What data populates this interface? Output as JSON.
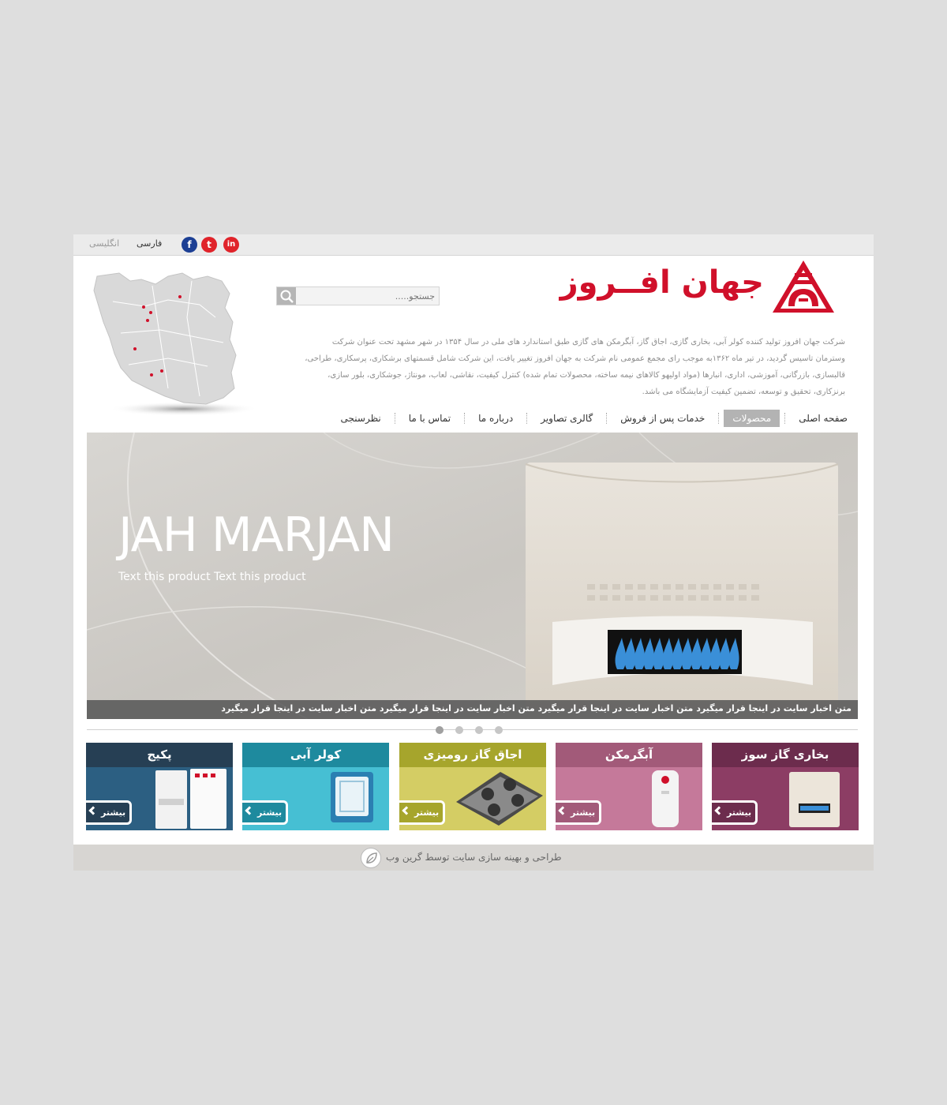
{
  "topbar": {
    "lang_fa": "فارسی",
    "lang_en": "انگلیسی",
    "social": [
      "facebook-icon",
      "twitter-icon",
      "linkedin-icon"
    ],
    "social_glyphs": {
      "facebook": "f",
      "twitter": "t",
      "linkedin": "in"
    }
  },
  "brand": {
    "name": "جهان افــروز",
    "color": "#d0102a"
  },
  "search": {
    "placeholder": "جستجو....."
  },
  "about": {
    "text": "شرکت جهان افروز تولید کننده کولر آبی، بخاری گازی، اجاق گاز، آبگرمکن های گازی طبق استاندارد های ملی در سال ۱۳۵۴ در شهر مشهد تحت عنوان شرکت وسترمان تاسیس گردید، در تیر ماه ۱۳۶۲به موجب رای مجمع عمومی نام شرکت به جهان افروز تغییر یافت، این شرکت شامل قسمتهای برشکاری، پرسکاری، طراحی، قالبسازی، بازرگانی، آموزشی، اداری، انبارها (مواد اولیهو کالاهای نیمه ساخته، محصولات تمام شده) کنترل کیفیت، نقاشی، لعاب، مونتاژ، جوشکاری، بلور سازی، برنزکاری، تحقیق و توسعه، تضمین کیفیت آزمایشگاه می باشد."
  },
  "nav": {
    "items": [
      {
        "label": "صفحه اصلی",
        "active": false
      },
      {
        "label": "محصولات",
        "active": true
      },
      {
        "label": "خدمات پس از فروش",
        "active": false
      },
      {
        "label": "گالری تصاویر",
        "active": false
      },
      {
        "label": "درباره ما",
        "active": false
      },
      {
        "label": "تماس با ما",
        "active": false
      },
      {
        "label": "نظرسنجی",
        "active": false
      }
    ]
  },
  "slider": {
    "title": "JAH MARJAN",
    "subtitle": "Text this product Text this product",
    "ticker": "متن اخبار سایت  در اینجا قرار میگیرد متن اخبار سایت  در اینجا قرار میگیرد متن اخبار سایت  در اینجا قرار میگیرد متن اخبار سایت  در اینجا قرار میگیرد",
    "dots_count": 4,
    "active_dot": 0
  },
  "categories": [
    {
      "title": "بخاری گاز سوز",
      "more": "بیشتر",
      "head_color": "#6c2c4d",
      "body_color": "#8c3d64",
      "btn_color": "#6c2c4d"
    },
    {
      "title": "آبگرمکن",
      "more": "بیشتر",
      "head_color": "#a25a79",
      "body_color": "#c5799a",
      "btn_color": "#a25a79"
    },
    {
      "title": "اجاق گاز رومیزی",
      "more": "بیشتر",
      "head_color": "#a6a52c",
      "body_color": "#d4cd64",
      "btn_color": "#a6a52c"
    },
    {
      "title": "کولر آبی",
      "more": "بیشتر",
      "head_color": "#1e8a9e",
      "body_color": "#46bfd3",
      "btn_color": "#1e8a9e"
    },
    {
      "title": "پکیج",
      "more": "بیشتر",
      "head_color": "#263f54",
      "body_color": "#2c5f82",
      "btn_color": "#263f54"
    }
  ],
  "footer": {
    "text": "طراحی و بهینه سازی سایت توسط گرین وب"
  }
}
